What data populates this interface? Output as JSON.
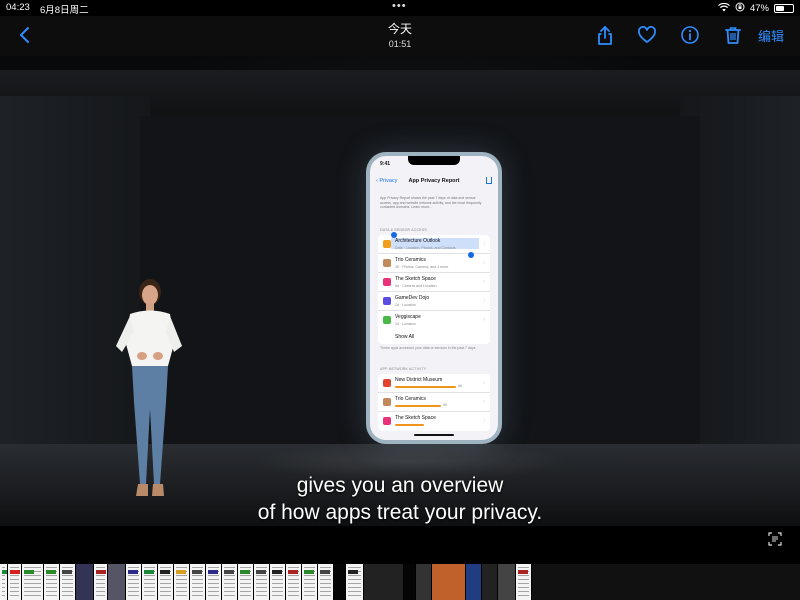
{
  "status_bar": {
    "time": "04:23",
    "date": "6月8日周二",
    "battery": "47%",
    "battery_level": 0.47,
    "wifi_icon": "wifi-icon",
    "orientation_lock_icon": "orientation-lock-icon"
  },
  "toolbar": {
    "back_icon": "chevron-left-icon",
    "title": "今天",
    "subtitle": "01:51",
    "share_icon": "share-icon",
    "favorite_icon": "heart-icon",
    "info_icon": "info-icon",
    "delete_icon": "trash-icon",
    "edit_label": "编辑",
    "accent_color": "#2f8cff"
  },
  "phone": {
    "time": "9:41",
    "back_label": "Privacy",
    "title": "App Privacy Report",
    "description": "App Privacy Report shows the past 7 days of data and sensor access, app and website network activity, and the most frequently contacted domains. Learn more...",
    "data_section_label": "DATA & SENSOR ACCESS",
    "data_rows": [
      {
        "name": "Architecture Outlook",
        "detail": "Data · Location, Photos, and Contacts",
        "color": "#f0a01c"
      },
      {
        "name": "Trio Ceramics",
        "detail": "26 · Photos, Camera, and 3 more",
        "color": "#c08a5a"
      },
      {
        "name": "The Sketch Space",
        "detail": "6d · Camera and Location",
        "color": "#e8337a"
      },
      {
        "name": "GameDev Dojo",
        "detail": "2d · Location",
        "color": "#5b4de0"
      },
      {
        "name": "Veggiscape",
        "detail": "2d · Location",
        "color": "#4cb848"
      }
    ],
    "show_all": "Show All",
    "data_note": "These apps accessed your data or sensors in the past 7 days.",
    "network_section_label": "APP NETWORK ACTIVITY",
    "network_rows": [
      {
        "name": "New District Museum",
        "value": "66",
        "fraction": 0.85,
        "color": "#e0442c"
      },
      {
        "name": "Trio Ceramics",
        "value": "50",
        "fraction": 0.64,
        "color": "#c08a5a"
      },
      {
        "name": "The Sketch Space",
        "value": "",
        "fraction": 0.4,
        "color": "#e8337a"
      }
    ]
  },
  "subtitles": {
    "line1": "gives you an overview",
    "line2": "of how apps treat your privacy."
  },
  "bottom": {
    "live_text_icon": "live-text-icon"
  }
}
